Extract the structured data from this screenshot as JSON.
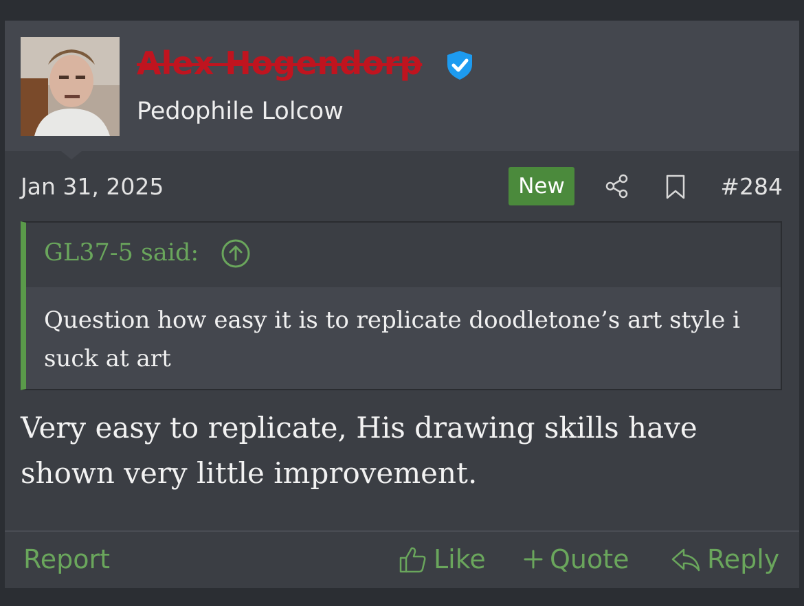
{
  "post": {
    "username": "Alex Hogendorp",
    "user_title": "Pedophile Lolcow",
    "date": "Jan 31, 2025",
    "new_badge": "New",
    "post_number": "#284",
    "message": "Very easy to replicate, His drawing skills have shown very little improvement."
  },
  "quote": {
    "author": "GL37-5 said:",
    "text": "Question how easy it is to replicate doodletone’s art style i suck at art"
  },
  "actions": {
    "report": "Report",
    "like": "Like",
    "quote": "Quote",
    "reply": "Reply"
  },
  "icons": [
    "verified-icon",
    "share-icon",
    "bookmark-icon",
    "quote-jump-icon",
    "like-icon",
    "quote-plus-icon",
    "reply-icon"
  ],
  "colors": {
    "accent": "#6aa65c",
    "username": "#c0141f",
    "badge": "#4b8a3c",
    "verified": "#1d9bf0"
  }
}
